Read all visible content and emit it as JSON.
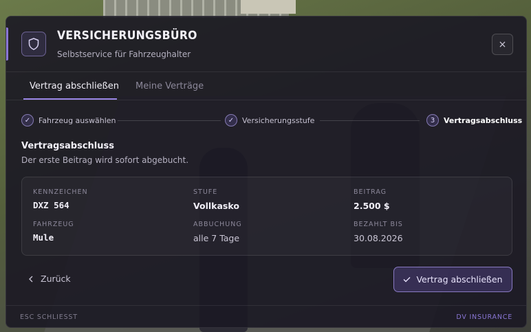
{
  "header": {
    "title": "VERSICHERUNGSBÜRO",
    "subtitle": "Selbstservice für Fahrzeughalter",
    "icon": "shield-icon",
    "close_label": "×"
  },
  "tabs": [
    {
      "label": "Vertrag abschließen",
      "active": true
    },
    {
      "label": "Meine Verträge",
      "active": false
    }
  ],
  "steps": [
    {
      "number": "✓",
      "label": "Fahrzeug auswählen",
      "state": "done"
    },
    {
      "number": "✓",
      "label": "Versicherungsstufe",
      "state": "done"
    },
    {
      "number": "3",
      "label": "Vertragsabschluss",
      "state": "current"
    }
  ],
  "section": {
    "title": "Vertragsabschluss",
    "description": "Der erste Beitrag wird sofort abgebucht."
  },
  "summary": {
    "plate_label": "KENNZEICHEN",
    "plate_value": "DXZ 564",
    "tier_label": "STUFE",
    "tier_value": "Vollkasko",
    "fee_label": "BEITRAG",
    "fee_value": "2.500 $",
    "vehicle_label": "FAHRZEUG",
    "vehicle_value": "Mule",
    "billing_label": "ABBUCHUNG",
    "billing_value": "alle 7 Tage",
    "paid_until_label": "BEZAHLT BIS",
    "paid_until_value": "30.08.2026"
  },
  "actions": {
    "back_label": "Zurück",
    "submit_label": "Vertrag abschließen"
  },
  "footer": {
    "left": "ESC SCHLIESST",
    "right": "DV INSURANCE"
  },
  "colors": {
    "accent": "#9a86e6",
    "panel": "#1b1824"
  }
}
